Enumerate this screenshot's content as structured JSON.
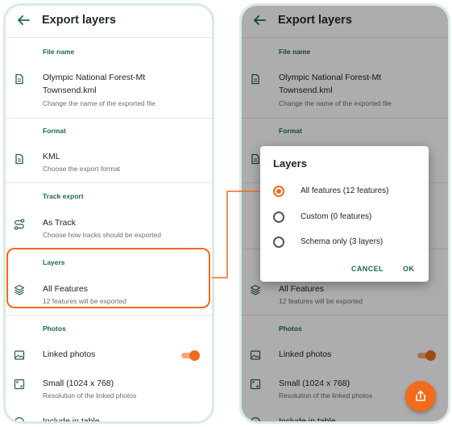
{
  "appbar": {
    "title": "Export layers"
  },
  "sections": {
    "file_name": "File name",
    "format": "Format",
    "track_export": "Track export",
    "layers": "Layers",
    "photos": "Photos"
  },
  "rows": {
    "file_title_line1": "Olympic National Forest-Mt",
    "file_title_line2": "Townsend.kml",
    "file_sub": "Change the name of the exported file",
    "format_title": "KML",
    "format_sub": "Choose the export format",
    "track_title": "As Track",
    "track_sub": "Choose how tracks should be exported",
    "layers_title": "All Features",
    "layers_sub": "12 features will be exported",
    "linked_photos": "Linked photos",
    "linked_photos_on": true,
    "size_title": "Small (1024 x 768)",
    "size_sub": "Resolution of the linked photos",
    "partial_row": "Include in table"
  },
  "dialog": {
    "title": "Layers",
    "options": [
      {
        "label": "All features (12 features)",
        "selected": true
      },
      {
        "label": "Custom (0 features)",
        "selected": false
      },
      {
        "label": "Schema only (3 layers)",
        "selected": false
      }
    ],
    "cancel": "CANCEL",
    "ok": "OK"
  },
  "colors": {
    "accent": "#f26a1b",
    "green": "#1d6b44",
    "frame": "#d8ebe3"
  },
  "icons": {
    "back": "arrow-left-icon",
    "file": "file-icon",
    "route": "route-icon",
    "layers": "layers-icon",
    "image": "image-icon",
    "resize": "resize-icon",
    "share": "share-icon"
  }
}
